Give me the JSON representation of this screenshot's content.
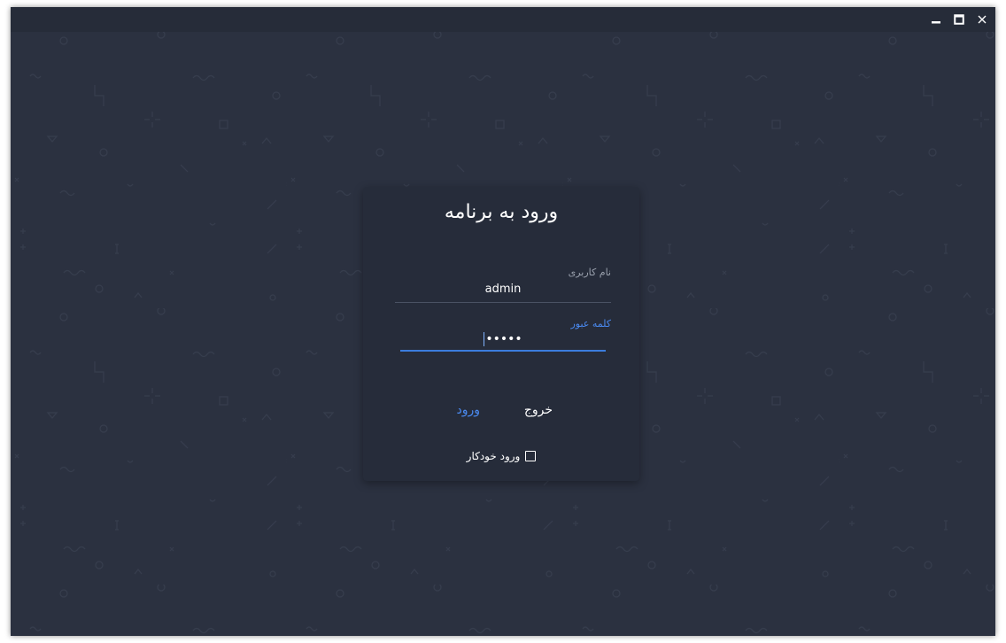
{
  "window": {
    "controls": [
      "minimize-icon",
      "maximize-icon",
      "close-icon"
    ]
  },
  "login": {
    "title": "ورود به برنامه",
    "username": {
      "label": "نام کاربری",
      "value": "admin"
    },
    "password": {
      "label": "کلمه عبور",
      "value": "•••••"
    },
    "exit_label": "خروج",
    "login_label": "ورود",
    "auto_login_label": "ورود خودکار",
    "auto_login_checked": false
  },
  "colors": {
    "background": "#2b3140",
    "card": "#262c3a",
    "accent": "#3b7ddd",
    "text": "#ffffff",
    "label": "#9aa1ad"
  }
}
